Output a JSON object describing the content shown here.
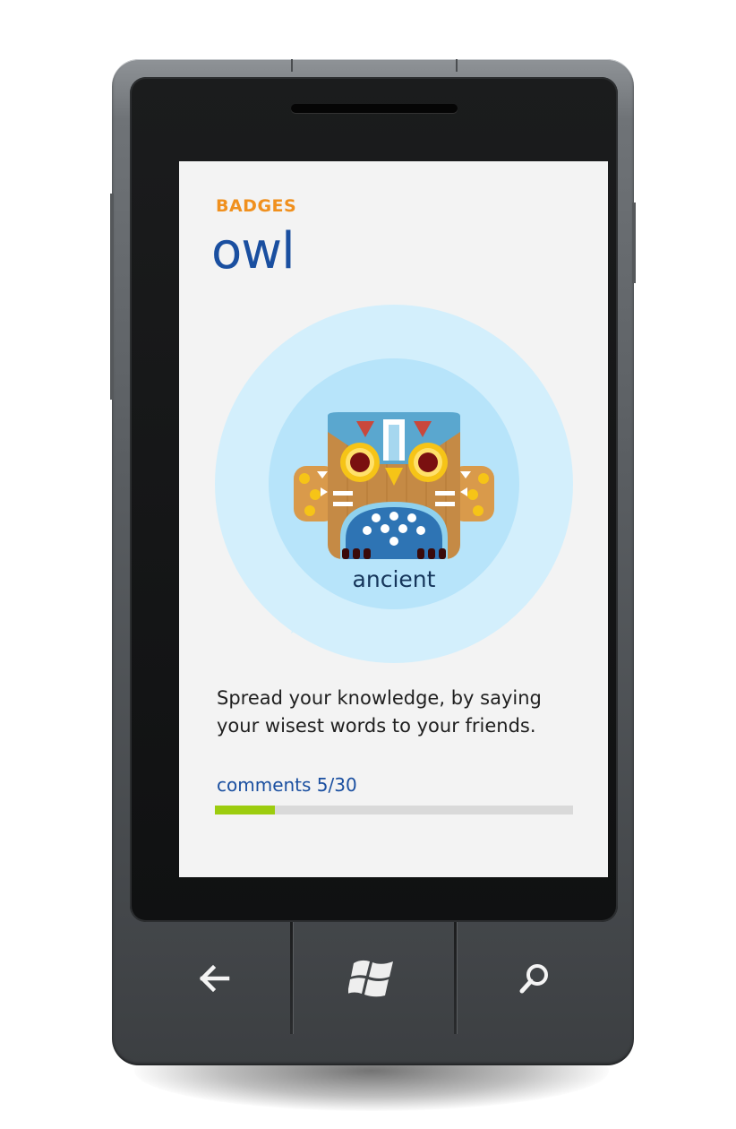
{
  "screen": {
    "page_label": "BADGES",
    "title": "owl",
    "badge": {
      "caption": "ancient",
      "icon": "owl-badge-icon"
    },
    "description": "Spread your knowledge, by saying your wisest words to your friends.",
    "progress": {
      "label": "comments 5/30",
      "current": 5,
      "total": 30
    }
  },
  "hardware_buttons": [
    {
      "name": "back",
      "icon": "back-arrow-icon"
    },
    {
      "name": "start",
      "icon": "windows-logo-icon"
    },
    {
      "name": "search",
      "icon": "search-icon"
    }
  ],
  "colors": {
    "accent_orange": "#f0901e",
    "title_blue": "#1a4fa0",
    "progress_green": "#9ccc0e",
    "bubble_light": "#d3effc",
    "bubble_mid": "#b7e4fa"
  }
}
